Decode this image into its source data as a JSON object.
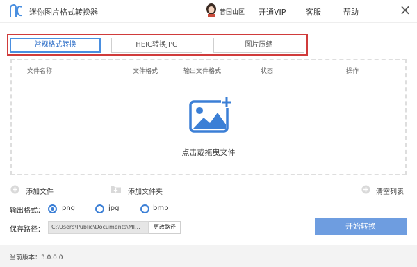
{
  "app": {
    "title": "迷你图片格式转换器"
  },
  "header": {
    "user_name": "昔国山区",
    "vip_label": "开通VIP",
    "service_label": "客服",
    "help_label": "帮助"
  },
  "tabs": [
    {
      "label": "常规格式转换",
      "active": true
    },
    {
      "label": "HEIC转换JPG",
      "active": false
    },
    {
      "label": "图片压缩",
      "active": false
    }
  ],
  "table": {
    "headers": {
      "name": "文件名称",
      "format": "文件格式",
      "output_format": "输出文件格式",
      "status": "状态",
      "action": "操作"
    }
  },
  "drop_zone": {
    "hint": "点击或拖曳文件"
  },
  "actions": {
    "add_file": "添加文件",
    "add_folder": "添加文件夹",
    "clear_list": "清空列表"
  },
  "output": {
    "label": "输出格式：",
    "options": [
      {
        "label": "png",
        "selected": true
      },
      {
        "label": "jpg",
        "selected": false
      },
      {
        "label": "bmp",
        "selected": false
      }
    ]
  },
  "save": {
    "label": "保存路径：",
    "path": "C:\\Users\\Public\\Documents\\MI...",
    "change_label": "更改路径"
  },
  "start_label": "开始转换",
  "footer": {
    "version": "当前版本：3.0.0.0"
  },
  "colors": {
    "accent": "#4a8fe0",
    "start_button": "#6e9de0",
    "tabs_frame": "#d03b3b"
  }
}
